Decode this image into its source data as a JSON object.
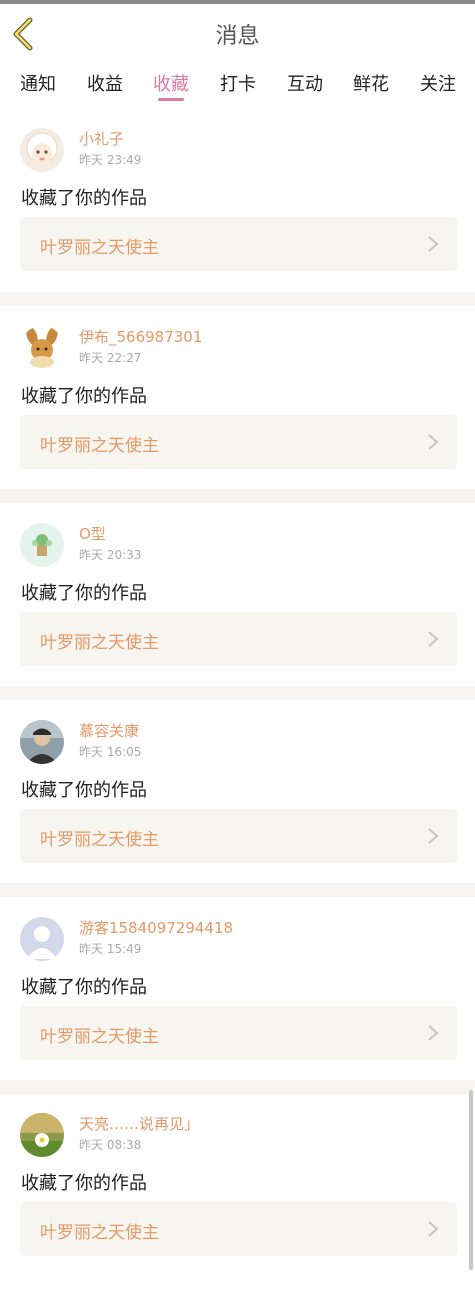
{
  "header": {
    "title": "消息"
  },
  "tabs": [
    {
      "label": "通知"
    },
    {
      "label": "收益"
    },
    {
      "label": "收藏",
      "active": true
    },
    {
      "label": "打卡"
    },
    {
      "label": "互动"
    },
    {
      "label": "鲜花"
    },
    {
      "label": "关注"
    }
  ],
  "messages": [
    {
      "username": "小礼子",
      "time": "昨天 23:49",
      "action": "收藏了你的作品",
      "work": "叶罗丽之天使主",
      "avatar": "sheep-avatar"
    },
    {
      "username": "伊布_566987301",
      "time": "昨天 22:27",
      "action": "收藏了你的作品",
      "work": "叶罗丽之天使主",
      "avatar": "eevee-avatar"
    },
    {
      "username": "O型",
      "time": "昨天 20:33",
      "action": "收藏了你的作品",
      "work": "叶罗丽之天使主",
      "avatar": "plant-avatar"
    },
    {
      "username": "慕容关康",
      "time": "昨天 16:05",
      "action": "收藏了你的作品",
      "work": "叶罗丽之天使主",
      "avatar": "person-avatar"
    },
    {
      "username": "游客1584097294418",
      "time": "昨天 15:49",
      "action": "收藏了你的作品",
      "work": "叶罗丽之天使主",
      "avatar": "default-avatar"
    },
    {
      "username": "天亮……说再见」",
      "time": "昨天 08:38",
      "action": "收藏了你的作品",
      "work": "叶罗丽之天使主",
      "avatar": "daisy-avatar"
    }
  ],
  "colors": {
    "accent": "#d97aa5",
    "name": "#e69866",
    "work_bg": "#f6f5ef"
  }
}
